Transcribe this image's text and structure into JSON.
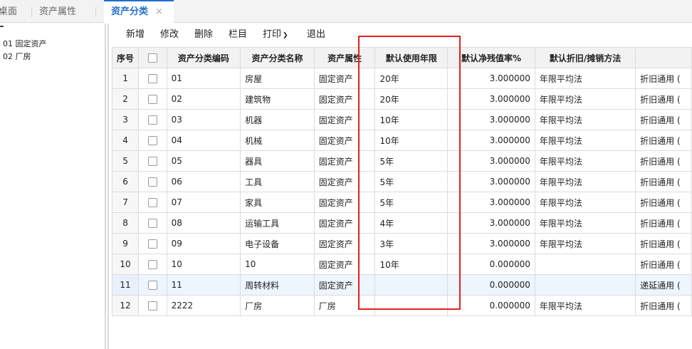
{
  "tabs": [
    {
      "label": "桌面"
    },
    {
      "label": "资产属性"
    },
    {
      "label": "资产分类",
      "close": "×"
    }
  ],
  "tree": {
    "items": [
      {
        "label": "01 固定资产"
      },
      {
        "label": "02 厂房"
      }
    ]
  },
  "toolbar": {
    "add": "新增",
    "edit": "修改",
    "delete": "删除",
    "columns": "栏目",
    "print": "打印",
    "exit": "退出"
  },
  "table": {
    "headers": {
      "seq": "序号",
      "code": "资产分类编码",
      "name": "资产分类名称",
      "attr": "资产属性",
      "life": "默认使用年限",
      "residual": "默认净残值率%",
      "method": "默认折旧/摊销方法",
      "extra": ""
    },
    "rows": [
      {
        "seq": "1",
        "code": "01",
        "name": "房屋",
        "attr": "固定资产",
        "life": "20年",
        "residual": "3.000000",
        "method": "年限平均法",
        "extra": "折旧通用 ("
      },
      {
        "seq": "2",
        "code": "02",
        "name": "建筑物",
        "attr": "固定资产",
        "life": "20年",
        "residual": "3.000000",
        "method": "年限平均法",
        "extra": "折旧通用 ("
      },
      {
        "seq": "3",
        "code": "03",
        "name": "机器",
        "attr": "固定资产",
        "life": "10年",
        "residual": "3.000000",
        "method": "年限平均法",
        "extra": "折旧通用 ("
      },
      {
        "seq": "4",
        "code": "04",
        "name": "机械",
        "attr": "固定资产",
        "life": "10年",
        "residual": "3.000000",
        "method": "年限平均法",
        "extra": "折旧通用 ("
      },
      {
        "seq": "5",
        "code": "05",
        "name": "器具",
        "attr": "固定资产",
        "life": "5年",
        "residual": "3.000000",
        "method": "年限平均法",
        "extra": "折旧通用 ("
      },
      {
        "seq": "6",
        "code": "06",
        "name": "工具",
        "attr": "固定资产",
        "life": "5年",
        "residual": "3.000000",
        "method": "年限平均法",
        "extra": "折旧通用 ("
      },
      {
        "seq": "7",
        "code": "07",
        "name": "家具",
        "attr": "固定资产",
        "life": "5年",
        "residual": "3.000000",
        "method": "年限平均法",
        "extra": "折旧通用 ("
      },
      {
        "seq": "8",
        "code": "08",
        "name": "运输工具",
        "attr": "固定资产",
        "life": "4年",
        "residual": "3.000000",
        "method": "年限平均法",
        "extra": "折旧通用 ("
      },
      {
        "seq": "9",
        "code": "09",
        "name": "电子设备",
        "attr": "固定资产",
        "life": "3年",
        "residual": "3.000000",
        "method": "年限平均法",
        "extra": "折旧通用 ("
      },
      {
        "seq": "10",
        "code": "10",
        "name": "10",
        "attr": "固定资产",
        "life": "10年",
        "residual": "0.000000",
        "method": "",
        "extra": "折旧通用 ("
      },
      {
        "seq": "11",
        "code": "11",
        "name": "周转材料",
        "attr": "固定资产",
        "life": "",
        "residual": "0.000000",
        "method": "",
        "extra": "递延通用 ("
      },
      {
        "seq": "12",
        "code": "2222",
        "name": "厂房",
        "attr": "厂房",
        "life": "",
        "residual": "0.000000",
        "method": "年限平均法",
        "extra": "折旧通用 ("
      }
    ],
    "highlighted_row": 11
  },
  "colors": {
    "accent": "#1e6fd0",
    "annotation_box": "#e02020",
    "highlight_row": "#edf5fd"
  }
}
